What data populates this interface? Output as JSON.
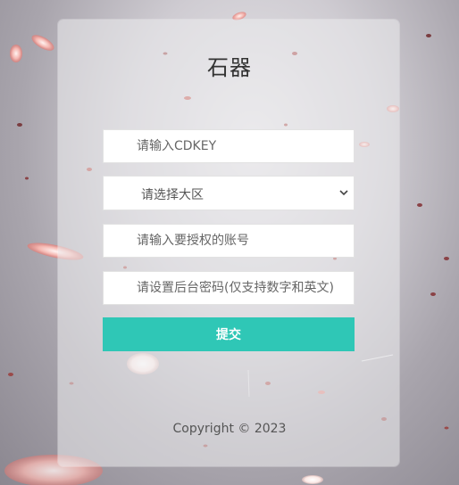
{
  "form": {
    "title": "石器",
    "cdkey_placeholder": "请输入CDKEY",
    "region_select": {
      "selected": "请选择大区"
    },
    "account_placeholder": "请输入要授权的账号",
    "password_placeholder": "请设置后台密码(仅支持数字和英文)",
    "submit_label": "提交"
  },
  "footer": {
    "copyright": "Copyright © 2023"
  },
  "theme": {
    "accent": "#2fc7b6"
  }
}
